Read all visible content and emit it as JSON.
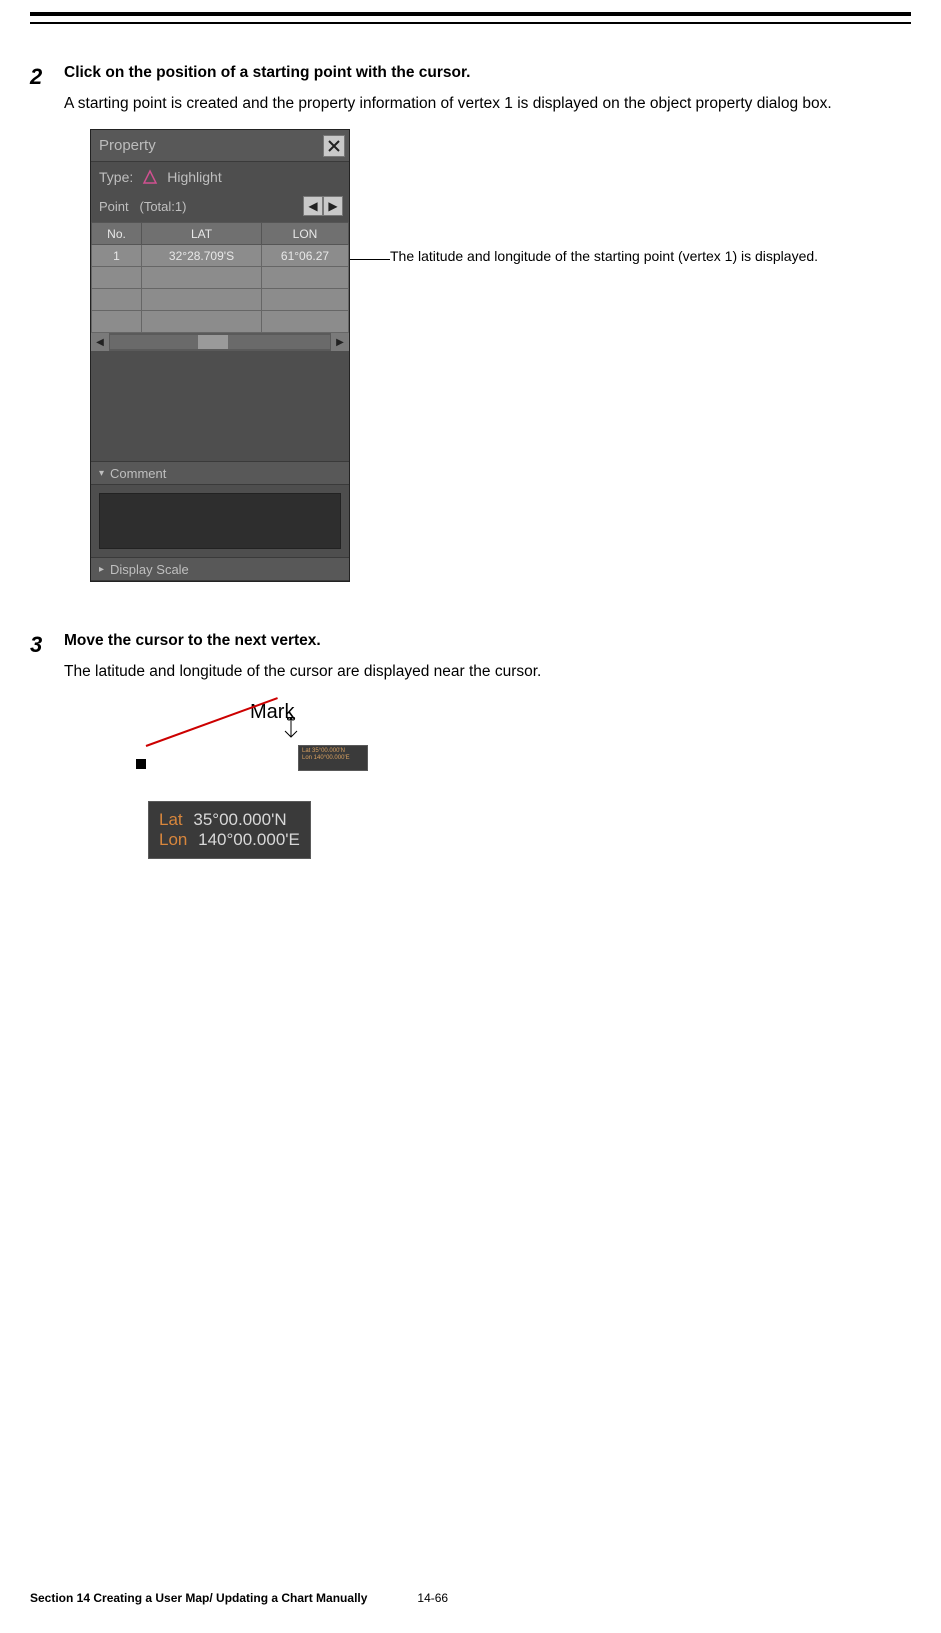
{
  "step2": {
    "num": "2",
    "title": "Click on the position of a starting point with the cursor.",
    "desc": "A starting point is created and the property information of vertex 1 is displayed on the object property dialog box."
  },
  "callout": "The latitude and longitude of the starting point (vertex 1) is displayed.",
  "property": {
    "title": "Property",
    "type_label": "Type:",
    "type_value": "Highlight",
    "point_label": "Point",
    "total_label": "(Total:1)",
    "headers": {
      "no": "No.",
      "lat": "LAT",
      "lon": "LON"
    },
    "row": {
      "no": "1",
      "lat": "32°28.709'S",
      "lon": "61°06.27"
    },
    "comment_label": "Comment",
    "display_scale_label": "Display Scale"
  },
  "step3": {
    "num": "3",
    "title": "Move the cursor to the next vertex.",
    "desc": "The latitude and longitude of the cursor are displayed near the cursor."
  },
  "fig3": {
    "mark": "Mark",
    "small_lat": "Lat 35°00.000'N",
    "small_lon": "Lon 140°00.000'E",
    "lat_label": "Lat",
    "lat_value": "35°00.000'N",
    "lon_label": "Lon",
    "lon_value": "140°00.000'E"
  },
  "footer": {
    "section": "Section 14    Creating a User Map/ Updating a Chart Manually",
    "page": "14-66"
  }
}
